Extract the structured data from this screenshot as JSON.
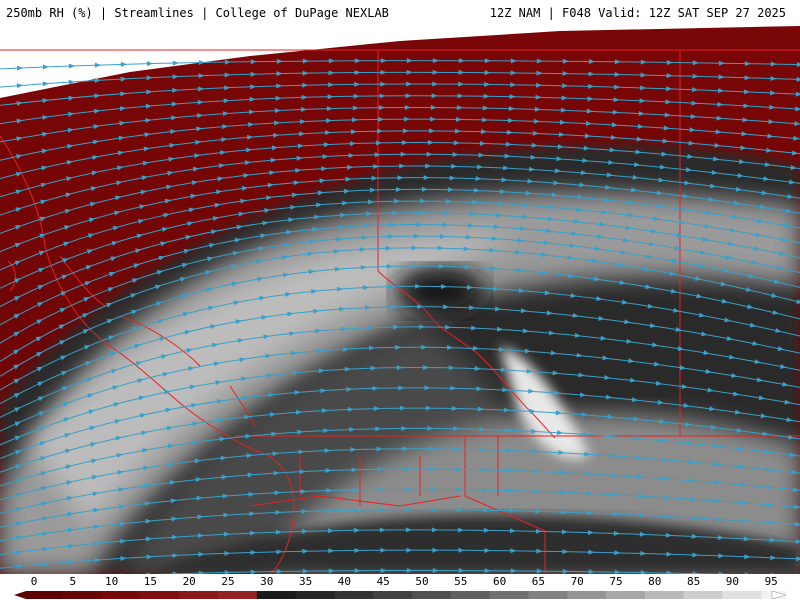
{
  "header": {
    "left_title": "250mb RH (%) | Streamlines | College of DuPage NEXLAB",
    "right_title": "12Z NAM | F048 Valid: 12Z SAT SEP 27 2025"
  },
  "map": {
    "variable": "250mb RH (%)",
    "overlay": "Streamlines",
    "streamline_color": "#3aa0c8",
    "border_color": "#e82020"
  },
  "colorbar": {
    "labels": [
      "0",
      "5",
      "10",
      "15",
      "20",
      "25",
      "30",
      "35",
      "40",
      "45",
      "50",
      "55",
      "60",
      "65",
      "70",
      "75",
      "80",
      "85",
      "90",
      "95"
    ],
    "colors": [
      "#5e0000",
      "#6a0505",
      "#760a0a",
      "#7f1010",
      "#8a1818",
      "#952222",
      "#1a1a1a",
      "#262626",
      "#333333",
      "#414141",
      "#505050",
      "#606060",
      "#707070",
      "#828282",
      "#949494",
      "#a7a7a7",
      "#bababa",
      "#cdcdcd",
      "#e0e0e0",
      "#f2f2f2"
    ]
  }
}
